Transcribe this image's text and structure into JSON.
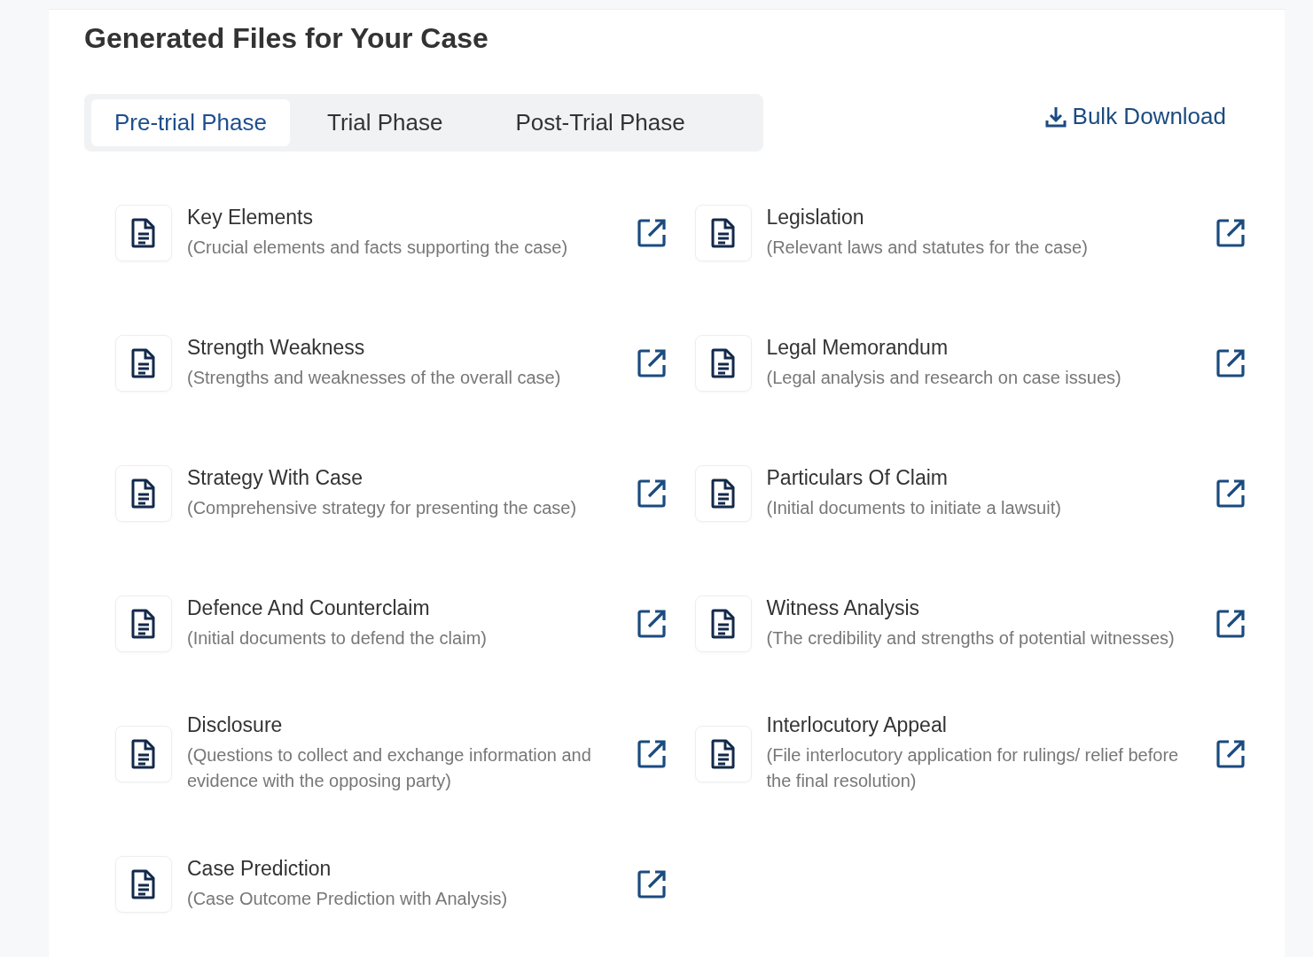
{
  "title": "Generated Files for Your Case",
  "tabs": [
    {
      "label": "Pre-trial Phase",
      "selected": true
    },
    {
      "label": "Trial Phase",
      "selected": false
    },
    {
      "label": "Post-Trial Phase",
      "selected": false
    }
  ],
  "bulk_download": "Bulk Download",
  "files": [
    {
      "name": "Key Elements",
      "description": "(Crucial elements and facts supporting the case)"
    },
    {
      "name": "Legislation",
      "description": "(Relevant laws and statutes for the case)"
    },
    {
      "name": "Strength Weakness",
      "description": "(Strengths and weaknesses of the overall case)"
    },
    {
      "name": "Legal Memorandum",
      "description": "(Legal analysis and research on case issues)"
    },
    {
      "name": "Strategy With Case",
      "description": "(Comprehensive strategy for presenting the case)"
    },
    {
      "name": "Particulars Of Claim",
      "description": "(Initial documents to initiate a lawsuit)"
    },
    {
      "name": "Defence And Counterclaim",
      "description": "(Initial documents to defend the claim)"
    },
    {
      "name": "Witness Analysis",
      "description": "(The credibility and strengths of potential witnesses)"
    },
    {
      "name": "Disclosure",
      "description": "(Questions to collect and exchange information and evidence with the opposing party)"
    },
    {
      "name": "Interlocutory Appeal",
      "description": "(File interlocutory application for rulings/ relief before the final resolution)"
    },
    {
      "name": "Case Prediction",
      "description": "(Case Outcome Prediction with Analysis)"
    }
  ]
}
